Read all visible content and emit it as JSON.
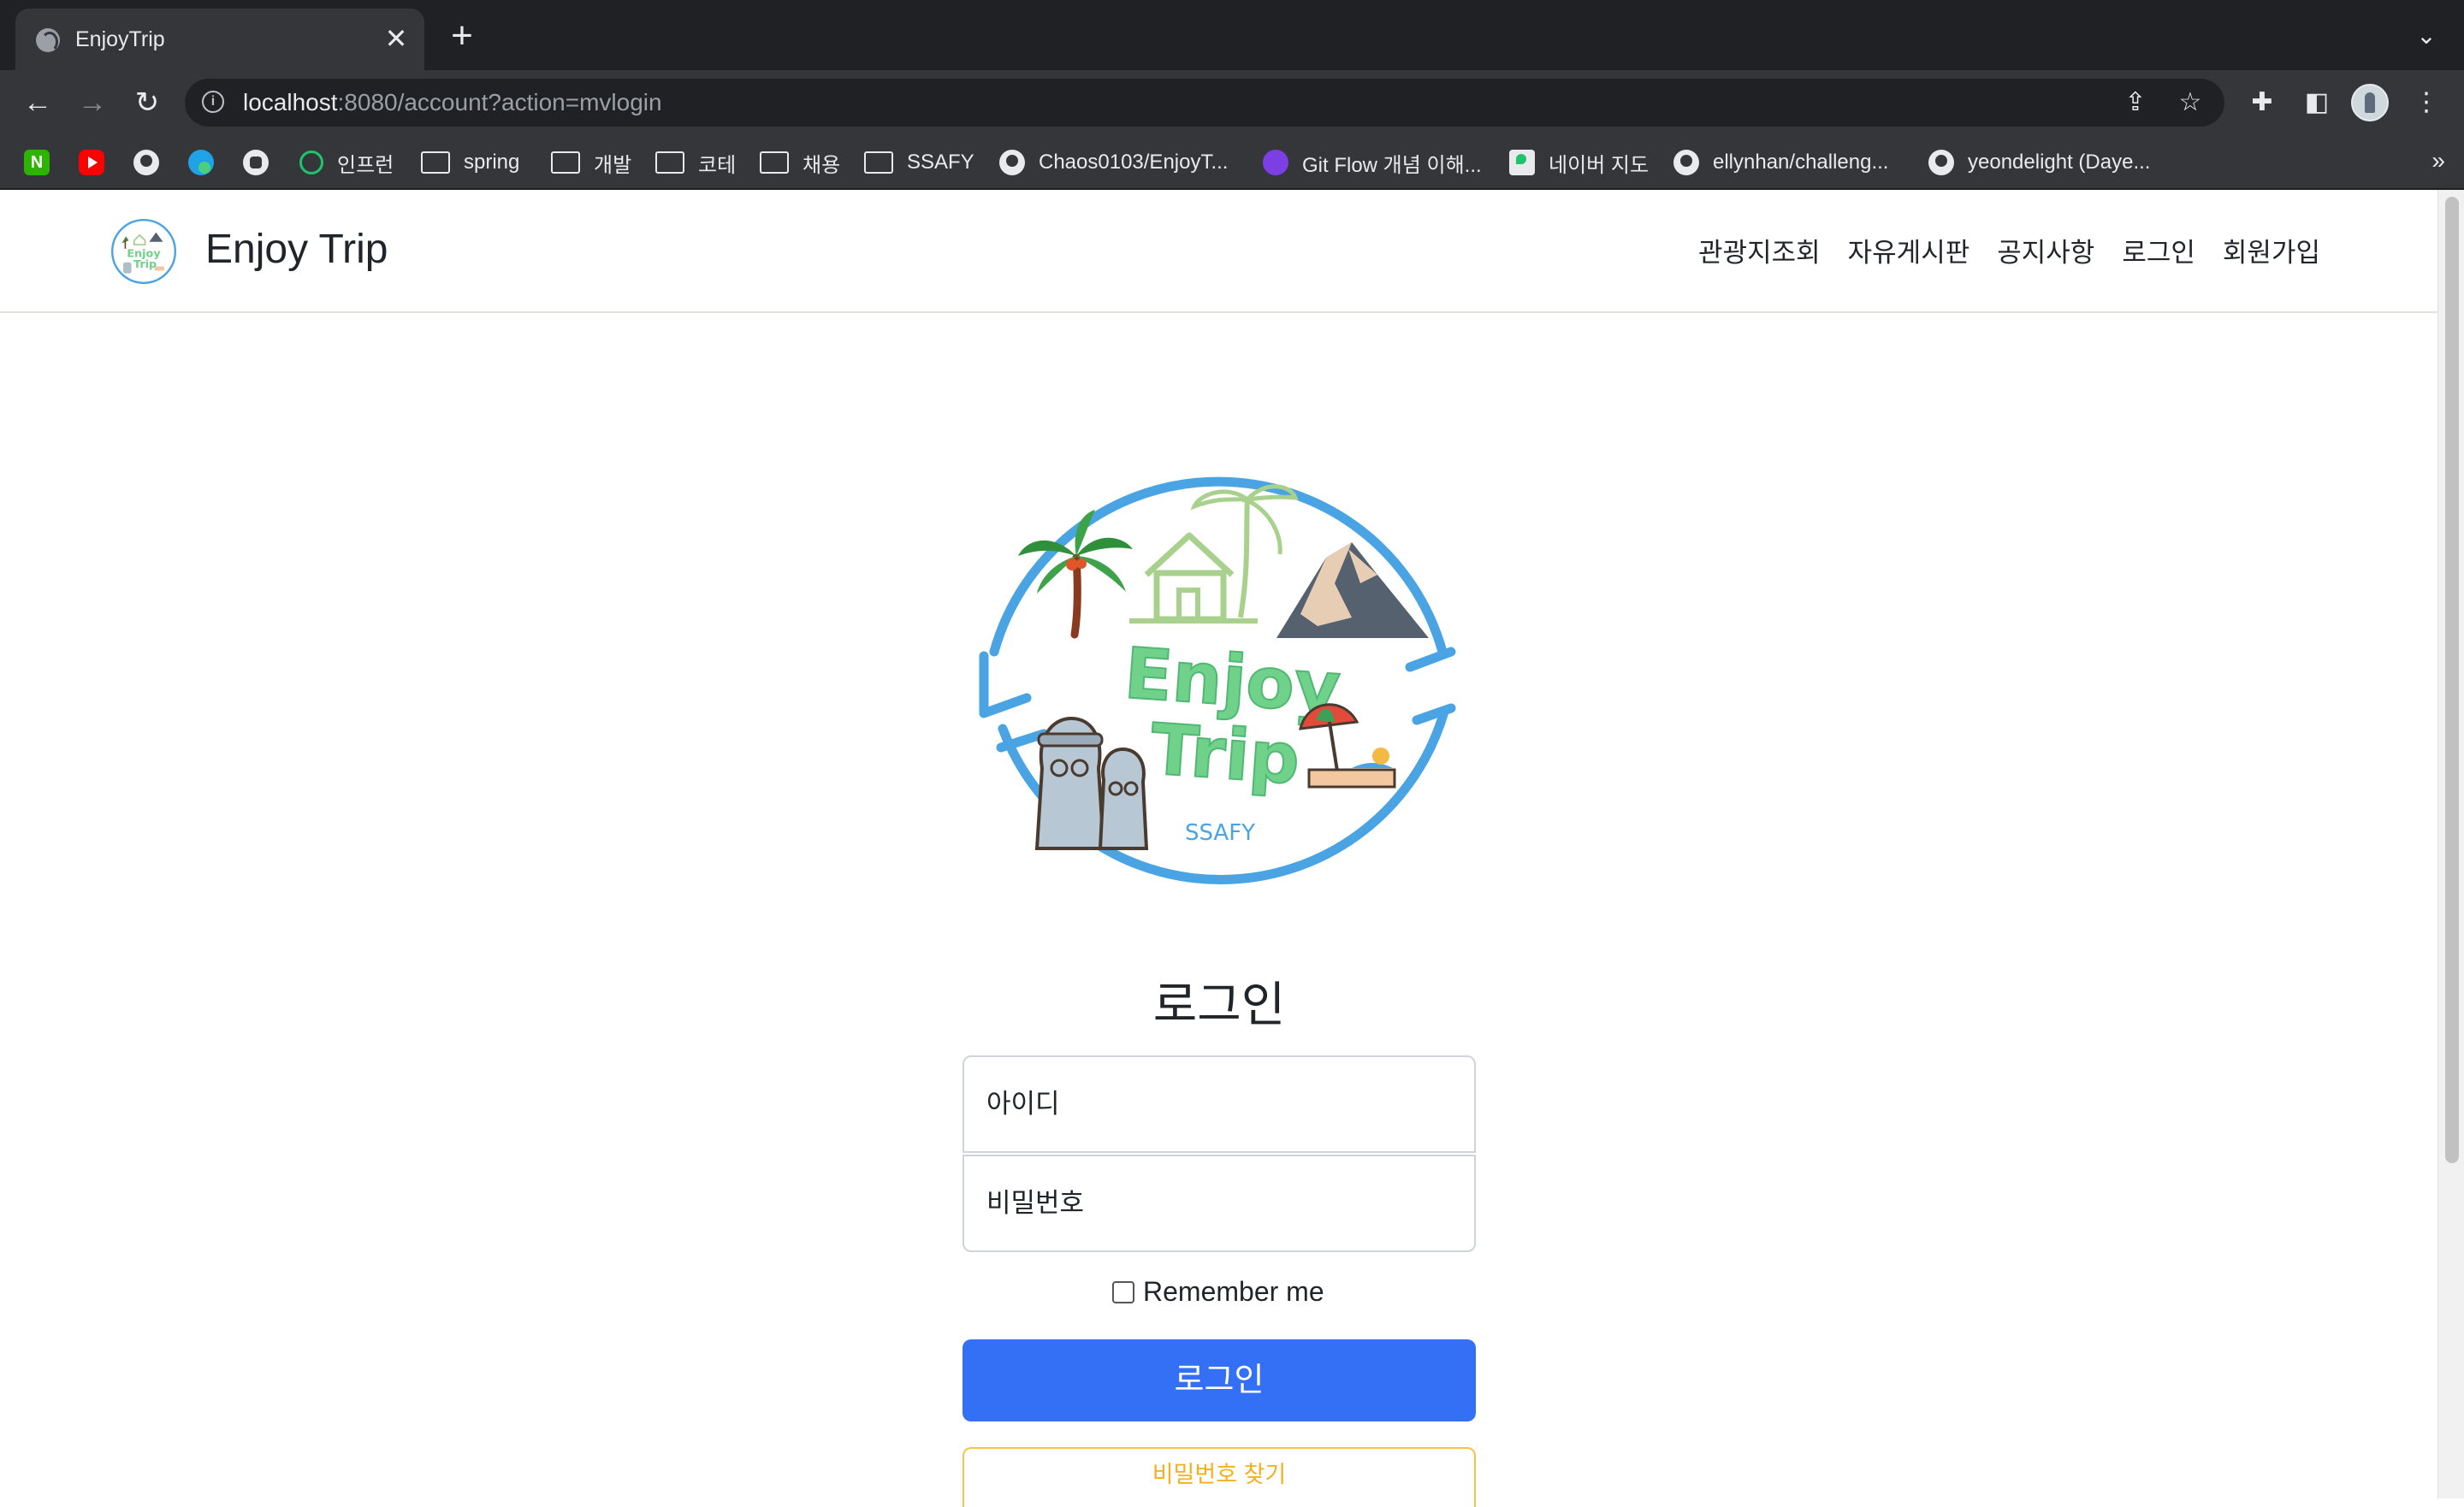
{
  "browser": {
    "tab_title": "EnjoyTrip",
    "tab_close": "✕",
    "new_tab": "+",
    "url_host": "localhost",
    "url_rest": ":8080/account?action=mvlogin",
    "bookmarks": [
      {
        "label": "",
        "icon": "naver-icon"
      },
      {
        "label": "",
        "icon": "youtube-icon"
      },
      {
        "label": "",
        "icon": "github-icon"
      },
      {
        "label": "",
        "icon": "edge-icon"
      },
      {
        "label": "",
        "icon": "openai-icon"
      },
      {
        "label": "인프런",
        "icon": "inflearn-icon"
      },
      {
        "label": "spring",
        "icon": "folder-icon"
      },
      {
        "label": "개발",
        "icon": "folder-icon"
      },
      {
        "label": "코테",
        "icon": "folder-icon"
      },
      {
        "label": "채용",
        "icon": "folder-icon"
      },
      {
        "label": "SSAFY",
        "icon": "folder-icon"
      },
      {
        "label": "Chaos0103/EnjoyT...",
        "icon": "github-icon"
      },
      {
        "label": "Git Flow 개념 이해...",
        "icon": "gitflow-icon"
      },
      {
        "label": "네이버 지도",
        "icon": "navermap-icon"
      },
      {
        "label": "ellynhan/challeng...",
        "icon": "github-icon"
      },
      {
        "label": "yeondelight (Daye...",
        "icon": "github-icon"
      }
    ],
    "bookmarks_more": "»"
  },
  "site": {
    "brand": "Enjoy Trip",
    "nav": [
      "관광지조회",
      "자유게시판",
      "공지사항",
      "로그인",
      "회원가입"
    ],
    "logo_text": {
      "line1": "Enjoy",
      "line2": "Trip",
      "small": "SSAFY"
    }
  },
  "login": {
    "title": "로그인",
    "id_placeholder": "아이디",
    "pw_placeholder": "비밀번호",
    "remember_label": "Remember me",
    "submit_label": "로그인",
    "find_pw_label": "비밀번호 찾기"
  },
  "colors": {
    "primary_button": "#3370f5",
    "warning_outline": "#f7c34a",
    "logo_ring": "#4aa3e3",
    "logo_text": "#6fd18a"
  }
}
